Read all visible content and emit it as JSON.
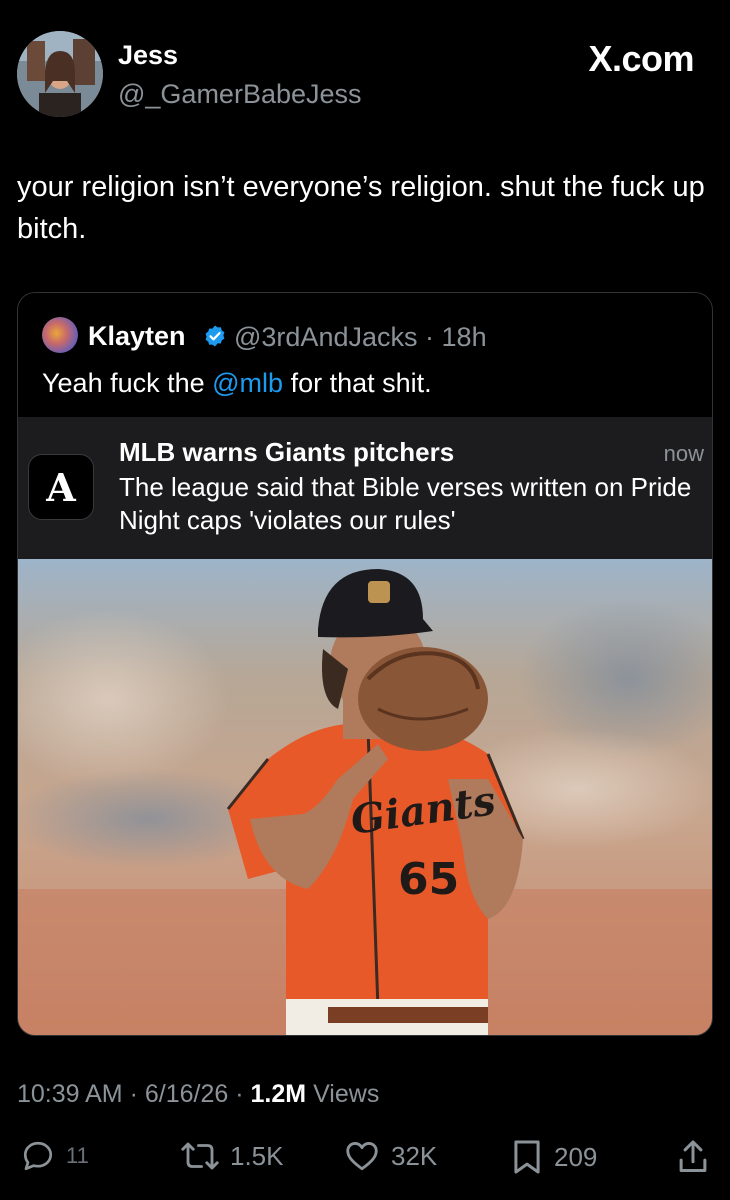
{
  "author": {
    "display_name": "Jess",
    "handle": "@_GamerBabeJess",
    "avatar_icon": "profile-photo"
  },
  "brand": "X.com",
  "tweet": {
    "text": "your religion isn’t everyone’s religion. shut the fuck up bitch."
  },
  "quoted": {
    "name": "Klayten",
    "verified_icon": "verified-badge-icon",
    "handle": "@3rdAndJacks",
    "separator": "·",
    "age": "18h",
    "text_before": "Yeah fuck the ",
    "mention": "@mlb",
    "text_after": " for that shit.",
    "notification": {
      "app_icon_letter": "A",
      "title": "MLB warns Giants pitchers",
      "time": "now",
      "body": "The league said that Bible verses written on Pride Night caps 'violates our rules'"
    },
    "photo": {
      "jersey_number": "65",
      "jersey_script": "Giants"
    }
  },
  "meta": {
    "time": "10:39 AM",
    "sep1": "·",
    "date": "6/16/26",
    "sep2": "·",
    "views_count": "1.2M",
    "views_label": "Views"
  },
  "actions": {
    "replies": "11",
    "reposts": "1.5K",
    "likes": "32K",
    "bookmarks": "209"
  },
  "colors": {
    "background": "#000000",
    "link": "#1d9bf0",
    "muted": "#8b9399",
    "jersey_orange": "#e8592a"
  }
}
